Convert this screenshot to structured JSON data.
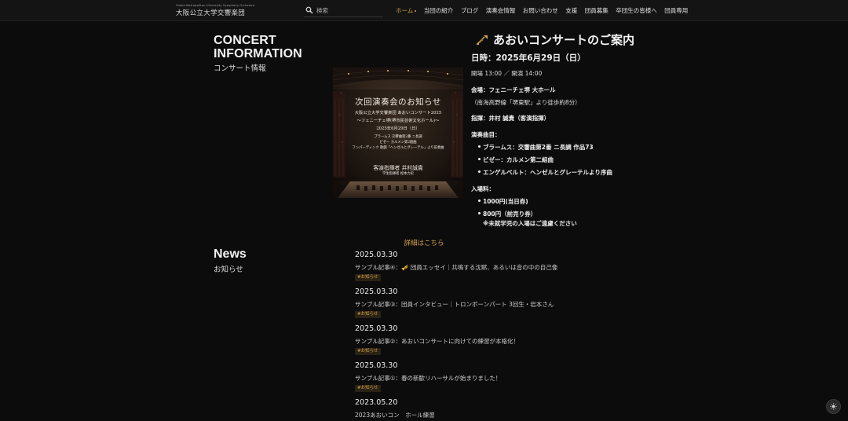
{
  "header": {
    "logo_small": "Osaka Metropolitan University Symphony Orchestra",
    "logo_main": "大阪公立大学交響楽団",
    "search_placeholder": "検索",
    "nav": [
      {
        "label": "ホーム",
        "active": true
      },
      {
        "label": "当団の紹介"
      },
      {
        "label": "ブログ"
      },
      {
        "label": "演奏会情報"
      },
      {
        "label": "お問い合わせ"
      },
      {
        "label": "支援"
      },
      {
        "label": "団員募集"
      },
      {
        "label": "卒団生の皆様へ"
      },
      {
        "label": "団員専用"
      }
    ]
  },
  "concert": {
    "section_title": "CONCERT INFORMATION",
    "section_subtitle": "コンサート情報",
    "poster": {
      "title": "次回演奏会のお知らせ",
      "line1": "大阪公立大学交響楽団 あおいコンサート2025",
      "line2": "〜フェニーチェ堺(堺市民芸術文化ホール)〜",
      "line3": "2025年6月29日（日）",
      "line4": "ブラームス 交響曲第2番 ニ長調",
      "line5": "ビゼー カルメン第2組曲",
      "line6": "フンパーディンク 歌劇「ヘンゼルとグレーテル」より前奏曲",
      "conductor": "客演指揮者 井村誠貴",
      "assistant": "学生指揮者 松本力史"
    },
    "title": "あおいコンサートのご案内",
    "date": "日時：2025年6月29日（日）",
    "time": "開場 13:00 ／ 開演 14:00",
    "venue": "会場：フェニーチェ堺 大ホール",
    "access": "（南海高野線「堺東駅」より徒歩約8分）",
    "conductor": "指揮：井村 誠貴（客演指揮）",
    "program_label": "演奏曲目：",
    "program": [
      "ブラームス：交響曲第2番 ニ長調 作品73",
      "ビゼー：カルメン第二組曲",
      "エンゲルベルト：ヘンゼルとグレーテルより序曲"
    ],
    "admission_label": "入場料：",
    "admission": [
      "1000円(当日券)",
      "800円（前売り券）"
    ],
    "admission_note": "※未就学児の入場はご遠慮ください",
    "more_link": "詳細はこちら"
  },
  "news": {
    "section_title": "News",
    "section_subtitle": "お知らせ",
    "items": [
      {
        "date": "2025.03.30",
        "title": "サンプル記事④：🎺 団員エッセイ｜共鳴する沈黙、あるいは音の中の自己像",
        "tag": "#お知らせ"
      },
      {
        "date": "2025.03.30",
        "title": "サンプル記事③：団員インタビュー｜トロンボーンパート 3回生・岩本さん",
        "tag": "#お知らせ"
      },
      {
        "date": "2025.03.30",
        "title": "サンプル記事②：あおいコンサートに向けての練習が本格化！",
        "tag": "#お知らせ"
      },
      {
        "date": "2025.03.30",
        "title": "サンプル記事①：春の新歓リハーサルが始まりました！",
        "tag": "#お知らせ"
      },
      {
        "date": "2023.05.20",
        "title": "2023あおいコン　ホール練習",
        "tag": ""
      }
    ]
  },
  "colors": {
    "accent": "#d4a24a",
    "background": "#0c0c0c",
    "header": "#141414"
  },
  "icons": {
    "search": "search-icon",
    "trumpet": "trumpet-icon",
    "theme": "sun-icon"
  }
}
